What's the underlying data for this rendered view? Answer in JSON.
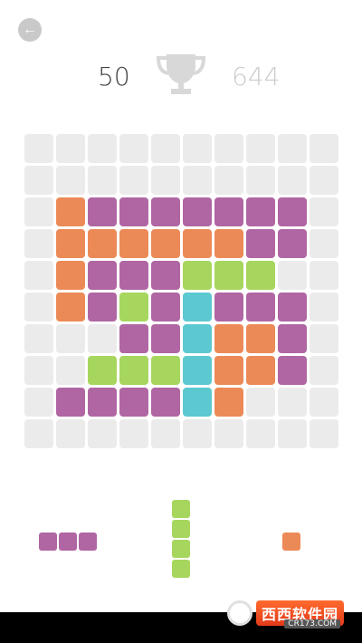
{
  "header": {
    "back_icon": "arrow-left-icon",
    "back_glyph": "←",
    "score": "50",
    "trophy_icon": "trophy-icon",
    "best_score": "644"
  },
  "colors": {
    "empty": "#ebebeb",
    "orange": "#ec8a57",
    "purple": "#b066a3",
    "green": "#a6d65d",
    "cyan": "#5cc9d0",
    "trophy": "#d8d8d8"
  },
  "board": {
    "rows": [
      [
        "E",
        "E",
        "E",
        "E",
        "E",
        "E",
        "E",
        "E",
        "E",
        "E"
      ],
      [
        "E",
        "E",
        "E",
        "E",
        "E",
        "E",
        "E",
        "E",
        "E",
        "E"
      ],
      [
        "E",
        "O",
        "P",
        "P",
        "P",
        "P",
        "P",
        "P",
        "P",
        "E"
      ],
      [
        "E",
        "O",
        "O",
        "O",
        "O",
        "O",
        "O",
        "P",
        "P",
        "E"
      ],
      [
        "E",
        "O",
        "P",
        "P",
        "P",
        "G",
        "G",
        "G",
        "E",
        "E"
      ],
      [
        "E",
        "O",
        "P",
        "G",
        "P",
        "C",
        "P",
        "P",
        "P",
        "E"
      ],
      [
        "E",
        "E",
        "E",
        "P",
        "P",
        "C",
        "O",
        "O",
        "P",
        "E"
      ],
      [
        "E",
        "E",
        "G",
        "G",
        "G",
        "C",
        "O",
        "O",
        "P",
        "E"
      ],
      [
        "E",
        "P",
        "P",
        "P",
        "P",
        "C",
        "O",
        "E",
        "E",
        "E"
      ],
      [
        "E",
        "E",
        "E",
        "E",
        "E",
        "E",
        "E",
        "E",
        "E",
        "E"
      ]
    ]
  },
  "pieces": [
    {
      "name": "piece-purple-horizontal-3",
      "color": "purple",
      "cols": 3,
      "rows": 1
    },
    {
      "name": "piece-green-vertical-4",
      "color": "green",
      "cols": 1,
      "rows": 4
    },
    {
      "name": "piece-orange-single",
      "color": "orange",
      "cols": 1,
      "rows": 1
    }
  ],
  "watermark": {
    "text": "西西软件园",
    "sub": "CR173.COM"
  }
}
